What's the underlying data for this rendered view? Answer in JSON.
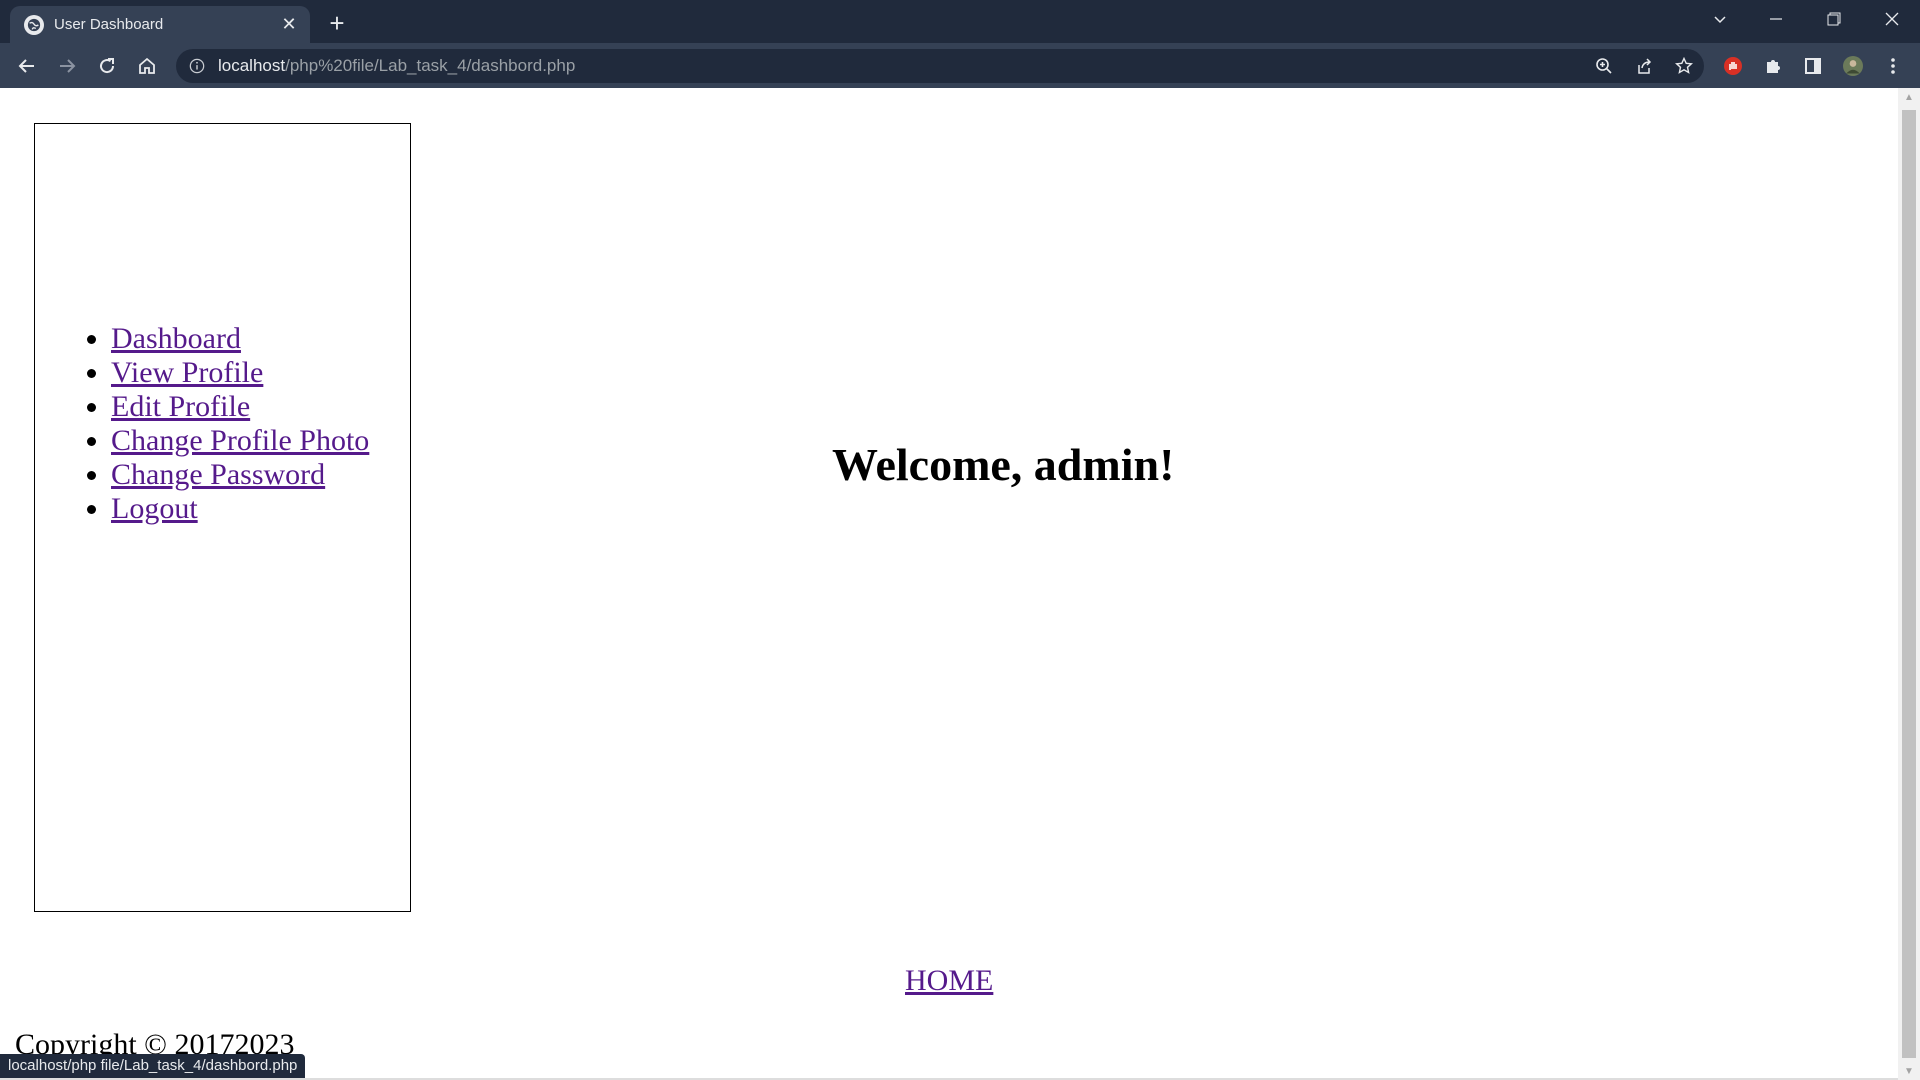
{
  "browser": {
    "tab_title": "User Dashboard",
    "tab_close": "✕",
    "new_tab": "+",
    "url_host": "localhost",
    "url_path": "/php%20file/Lab_task_4/dashbord.php",
    "status_url": "localhost/php file/Lab_task_4/dashbord.php",
    "icons": {
      "favicon": "globe-icon",
      "back": "back-arrow-icon",
      "forward": "forward-arrow-icon",
      "reload": "reload-icon",
      "home": "home-icon",
      "info": "info-icon",
      "zoom": "zoom-icon",
      "share": "share-icon",
      "bookmark": "star-icon",
      "extension_red": "red-hand-extension-icon",
      "extensions": "puzzle-icon",
      "side_panel": "side-panel-icon",
      "profile": "avatar",
      "menu": "kebab-menu-icon"
    }
  },
  "page": {
    "nav": [
      {
        "label": "Dashboard"
      },
      {
        "label": "View Profile"
      },
      {
        "label": "Edit Profile"
      },
      {
        "label": "Change Profile Photo"
      },
      {
        "label": "Change Password"
      },
      {
        "label": "Logout"
      }
    ],
    "welcome": "Welcome, admin!",
    "home_link": "HOME",
    "copyright": "Copyright © 20172023"
  },
  "colors": {
    "tabstrip_bg": "#202a3c",
    "toolbar_bg": "#354155",
    "visited_link": "#551a8b"
  }
}
